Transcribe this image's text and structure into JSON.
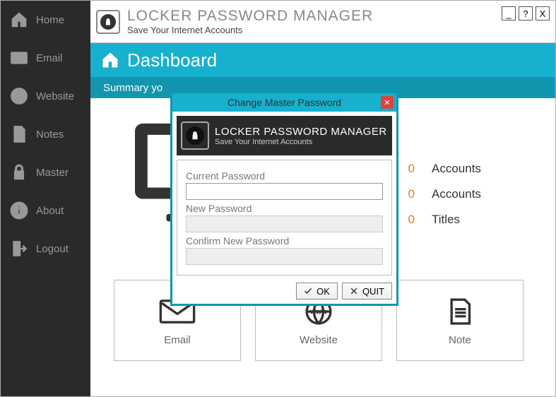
{
  "app": {
    "title": "LOCKER PASSWORD MANAGER",
    "subtitle": "Save Your Internet Accounts"
  },
  "winbtns": {
    "min": "_",
    "help": "?",
    "close": "X"
  },
  "sidebar": {
    "items": [
      {
        "label": "Home"
      },
      {
        "label": "Email"
      },
      {
        "label": "Website"
      },
      {
        "label": "Notes"
      },
      {
        "label": "Master"
      },
      {
        "label": "About"
      },
      {
        "label": "Logout"
      }
    ]
  },
  "hero": {
    "title": "Dashboard"
  },
  "summary": {
    "text": "Summary yo"
  },
  "stats": [
    {
      "count": "0",
      "label": "Accounts"
    },
    {
      "count": "0",
      "label": "Accounts"
    },
    {
      "count": "0",
      "label": "Titles"
    }
  ],
  "cards": [
    {
      "label": "Email"
    },
    {
      "label": "Website"
    },
    {
      "label": "Note"
    }
  ],
  "dialog": {
    "title": "Change Master Password",
    "header_title": "LOCKER PASSWORD MANAGER",
    "header_sub": "Save Your Internet Accounts",
    "field1": "Current Password",
    "field2": "New Password",
    "field3": "Confirm New Password",
    "ok": "OK",
    "quit": "QUIT"
  }
}
